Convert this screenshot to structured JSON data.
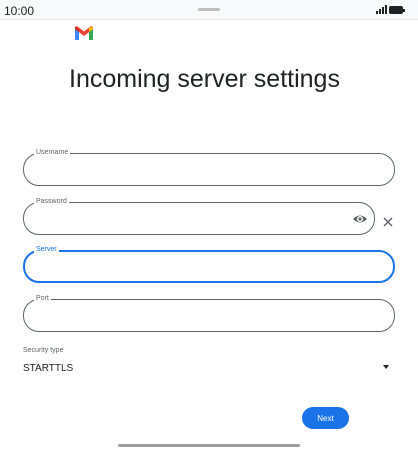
{
  "status_bar": {
    "time": "10:00"
  },
  "app": {
    "logo_icon": "gmail-logo-icon"
  },
  "page": {
    "title": "Incoming server settings"
  },
  "form": {
    "username": {
      "label": "Username",
      "value": ""
    },
    "password": {
      "label": "Password",
      "value": ""
    },
    "server": {
      "label": "Server",
      "value": ""
    },
    "port": {
      "label": "Port",
      "value": ""
    },
    "security_type": {
      "label": "Security type",
      "value": "STARTTLS"
    }
  },
  "actions": {
    "next_label": "Next"
  },
  "colors": {
    "accent": "#1a73e8",
    "outline": "#5f6368"
  }
}
